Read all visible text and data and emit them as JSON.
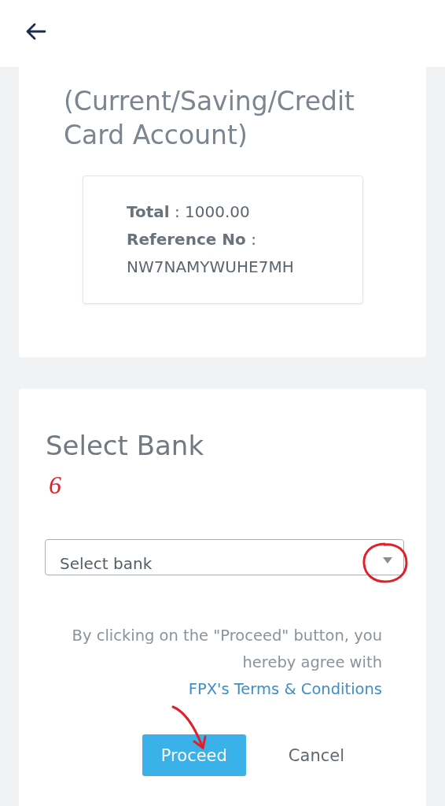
{
  "payment": {
    "title": "(Current/Saving/Credit Card Account)",
    "separator": ":",
    "total_label": "Total",
    "total_value": "1000.00",
    "reference_label": "Reference No",
    "reference_value": "NW7NAMYWUHE7MH"
  },
  "bank": {
    "title": "Select Bank",
    "annotation": "6",
    "select": {
      "placeholder": "Select bank"
    },
    "terms_text": "By clicking on the \"Proceed\" button, you hereby agree with",
    "terms_link": "FPX's Terms & Conditions",
    "buttons": [
      {
        "label": "Proceed",
        "kind": "primary"
      },
      {
        "label": "Cancel",
        "kind": "secondary"
      }
    ]
  }
}
